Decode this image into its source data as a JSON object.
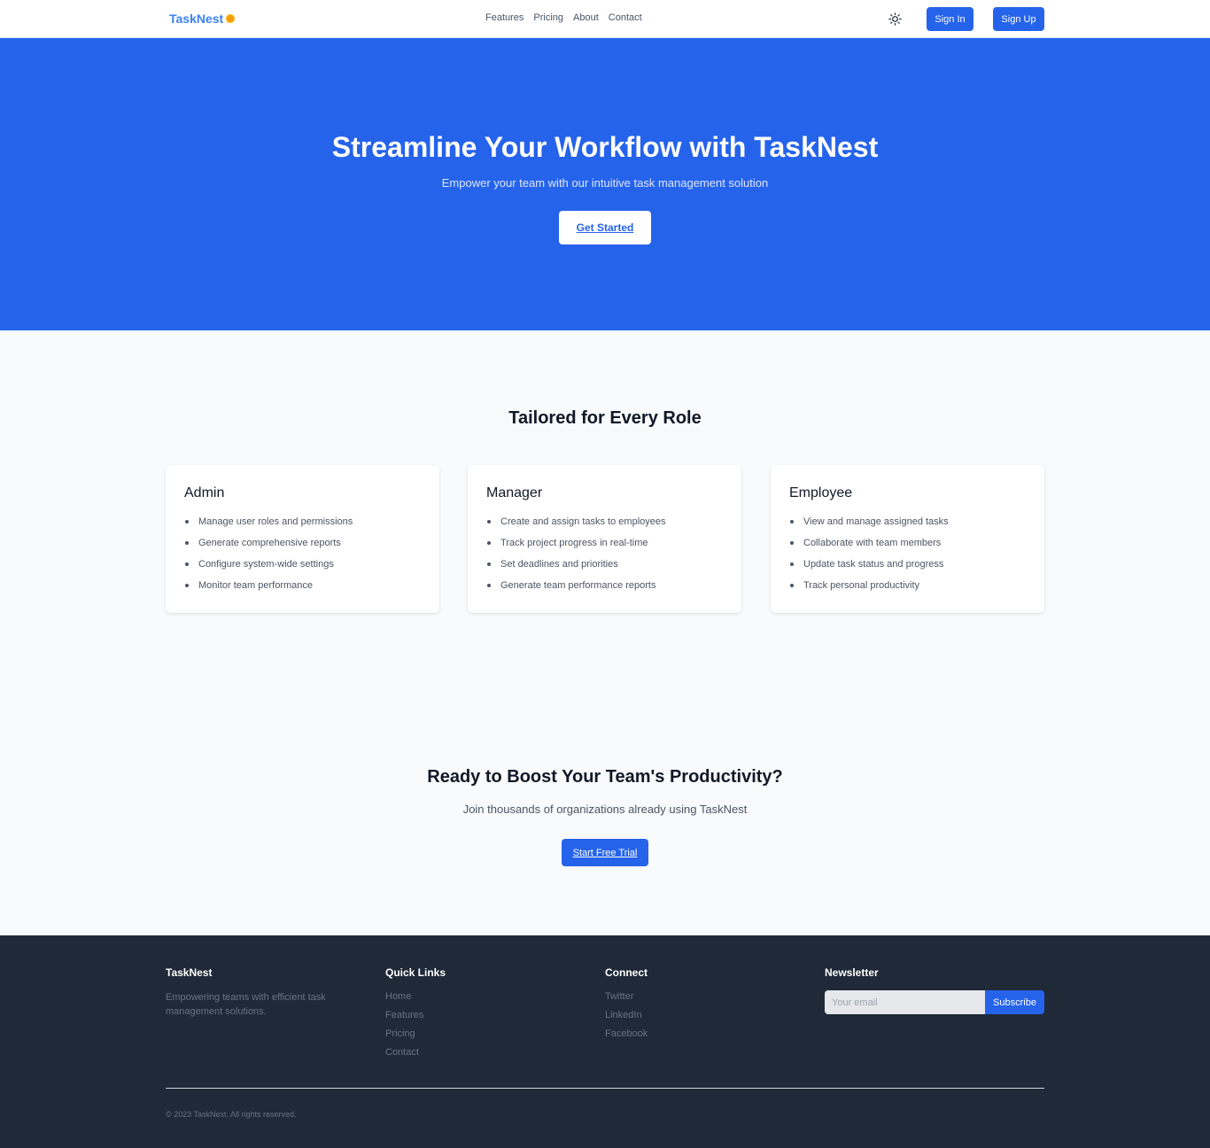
{
  "nav": {
    "logo": "TaskNest",
    "links": [
      "Features",
      "Pricing",
      "About",
      "Contact"
    ],
    "theme_icon": "sun-icon",
    "signin": "Sign In",
    "signup": "Sign Up"
  },
  "hero": {
    "title": "Streamline Your Workflow with TaskNest",
    "subtitle": "Empower your team with our intuitive task management solution",
    "cta": "Get Started"
  },
  "roles": {
    "title": "Tailored for Every Role",
    "cards": [
      {
        "title": "Admin",
        "items": [
          "Manage user roles and permissions",
          "Generate comprehensive reports",
          "Configure system-wide settings",
          "Monitor team performance"
        ]
      },
      {
        "title": "Manager",
        "items": [
          "Create and assign tasks to employees",
          "Track project progress in real-time",
          "Set deadlines and priorities",
          "Generate team performance reports"
        ]
      },
      {
        "title": "Employee",
        "items": [
          "View and manage assigned tasks",
          "Collaborate with team members",
          "Update task status and progress",
          "Track personal productivity"
        ]
      }
    ]
  },
  "cta": {
    "title": "Ready to Boost Your Team's Productivity?",
    "subtitle": "Join thousands of organizations already using TaskNest",
    "button": "Start Free Trial"
  },
  "footer": {
    "brand": {
      "title": "TaskNest",
      "text": "Empowering teams with efficient task management solutions."
    },
    "quick_links": {
      "title": "Quick Links",
      "links": [
        "Home",
        "Features",
        "Pricing",
        "Contact"
      ]
    },
    "connect": {
      "title": "Connect",
      "links": [
        "Twitter",
        "LinkedIn",
        "Facebook"
      ]
    },
    "newsletter": {
      "title": "Newsletter",
      "placeholder": "Your email",
      "button": "Subscribe"
    },
    "copyright": "© 2023 TaskNest. All rights reserved."
  },
  "colors": {
    "primary": "#2563eb",
    "accent_dot": "#f59e0b",
    "footer_bg": "#1f2937",
    "page_bg": "#f8fafc"
  }
}
